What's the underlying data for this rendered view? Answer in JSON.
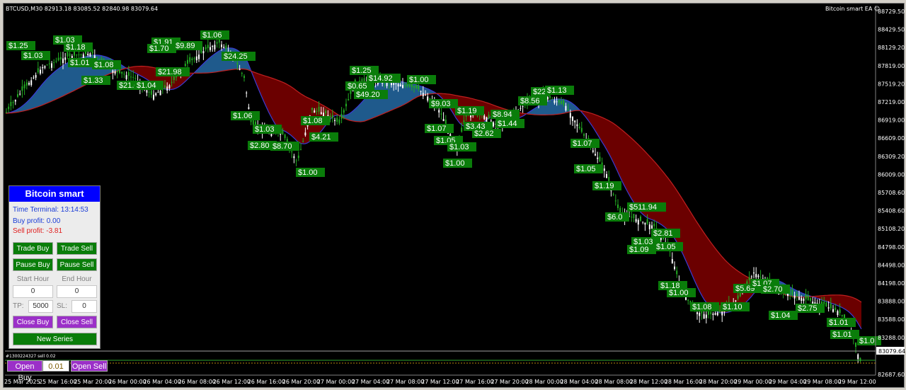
{
  "window": {
    "symbol_title": "BTCUSD,M30  82913.18 83085.52 82840.98 83079.64",
    "ea_label": "Bitcoin smart EA ☺"
  },
  "price_axis": [
    "88729.50",
    "88429.50",
    "88129.20",
    "87819.00",
    "87519.20",
    "87219.00",
    "86919.00",
    "86609.00",
    "86309.20",
    "86009.00",
    "85708.60",
    "85408.60",
    "85108.20",
    "84798.00",
    "84498.00",
    "84198.00",
    "83888.00",
    "83588.00",
    "83288.00",
    "83079.64",
    "82687.60"
  ],
  "current_price": "83079.64",
  "time_axis": [
    "25 Mar 2025",
    "25 Mar 16:00",
    "25 Mar 20:00",
    "26 Mar 00:00",
    "26 Mar 04:00",
    "26 Mar 08:00",
    "26 Mar 12:00",
    "26 Mar 16:00",
    "26 Mar 20:00",
    "27 Mar 00:00",
    "27 Mar 04:00",
    "27 Mar 08:00",
    "27 Mar 12:00",
    "27 Mar 16:00",
    "27 Mar 20:00",
    "28 Mar 00:00",
    "28 Mar 04:00",
    "28 Mar 08:00",
    "28 Mar 12:00",
    "28 Mar 16:00",
    "28 Mar 20:00",
    "29 Mar 00:00",
    "29 Mar 04:00",
    "29 Mar 08:00",
    "29 Mar 12:00"
  ],
  "colors": {
    "background": "#000000",
    "cloud_bull": "#1f5a8c",
    "cloud_bear": "#6b0000",
    "candle_up": "#ffffff",
    "candle_down": "#22aa22",
    "profit_label": "#0a7d0a",
    "panel_header": "#0000ff",
    "buy_text": "#1a3cd6",
    "sell_text": "#e02020",
    "purple_button": "#9b30c8"
  },
  "profit_labels": [
    "$1.25",
    "$1.03",
    "$1.18",
    "$1.03",
    "$1.01",
    "$1.08",
    "$1.33",
    "$21.04",
    "$1.04",
    "$1.91",
    "$1.70",
    "$9.89",
    "$21.98",
    "$1.06",
    "$24.25",
    "$1.06",
    "$1.03",
    "$2.80",
    "$8.70",
    "$1.08",
    "$4.21",
    "$1.00",
    "$1.25",
    "$0.65",
    "$14.92",
    "$49.20",
    "$1.00",
    "$9.03",
    "$1.07",
    "$1.05",
    "$1.03",
    "$1.00",
    "$1.19",
    "$3.43",
    "$2.62",
    "$8.94",
    "$1.44",
    "$8.56",
    "$22",
    "$1.13",
    "$1.07",
    "$1.05",
    "$1.19",
    "$511.94",
    "$6.0",
    "$2.81",
    "$1.03",
    "$1.09",
    "$1.05",
    "$1.18",
    "$1.00",
    "$1.08",
    "$1.10",
    "$5.69",
    "$1.07",
    "$2.70",
    "$1.04",
    "$2.75",
    "$1.01",
    "$1.01",
    "$1.0"
  ],
  "panel": {
    "title": "Bitcoin smart",
    "time_terminal": "Time Terminal: 13:14:53",
    "buy_profit": "Buy profit: 0.00",
    "sell_profit": "Sell profit: -3.81",
    "trade_buy": "Trade Buy",
    "trade_sell": "Trade Sell",
    "pause_buy": "Pause Buy",
    "pause_sell": "Pause Sell",
    "start_hour_label": "Start Hour",
    "end_hour_label": "End Hour",
    "start_hour_value": "0",
    "end_hour_value": "0",
    "tp_label": "TP:",
    "tp_value": "5000",
    "sl_label": "SL:",
    "sl_value": "0",
    "close_buy": "Close Buy",
    "close_sell": "Close Sell",
    "new_series": "New Series"
  },
  "bottom": {
    "order_info": "#1300224327 sell 0.02",
    "open_buy": "Open Buy",
    "lot_value": "0.01",
    "open_sell": "Open Sell"
  }
}
